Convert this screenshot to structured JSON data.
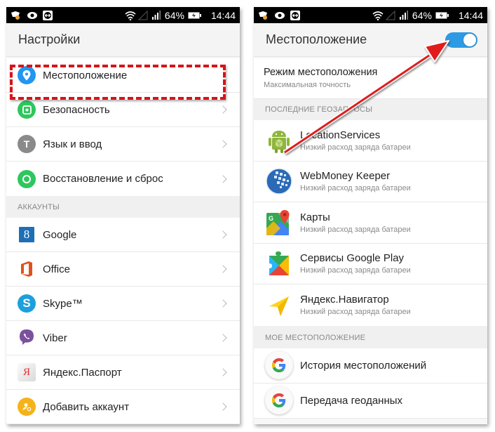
{
  "status_bar": {
    "battery": "64%",
    "time": "14:44",
    "left_icons": [
      "app-notification-icon",
      "eye-icon",
      "teamviewer-icon"
    ],
    "right_icons": [
      "wifi-icon",
      "no-signal-icon",
      "cell-signal-icon",
      "battery-charging-icon"
    ]
  },
  "left_screen": {
    "title": "Настройки",
    "settings_items": [
      {
        "label": "Местоположение",
        "icon": "location-pin-icon",
        "color": "#2196f3",
        "highlighted": true
      },
      {
        "label": "Безопасность",
        "icon": "security-icon",
        "color": "#2ec75d"
      },
      {
        "label": "Язык и ввод",
        "icon": "language-icon",
        "color": "#8a8a8a",
        "glyph": "T"
      },
      {
        "label": "Восстановление и сброс",
        "icon": "backup-reset-icon",
        "color": "#2ec75d"
      }
    ],
    "accounts_header": "АККАУНТЫ",
    "accounts": [
      {
        "label": "Google",
        "icon": "google-account-icon",
        "glyph": "8"
      },
      {
        "label": "Office",
        "icon": "office-icon"
      },
      {
        "label": "Skype™",
        "icon": "skype-icon",
        "glyph": "S"
      },
      {
        "label": "Viber",
        "icon": "viber-icon"
      },
      {
        "label": "Яндекс.Паспорт",
        "icon": "yandex-passport-icon",
        "glyph": "Я"
      },
      {
        "label": "Добавить аккаунт",
        "icon": "add-account-icon"
      }
    ],
    "highlight_color": "#d7141a"
  },
  "right_screen": {
    "title": "Местоположение",
    "toggle_on": true,
    "toggle_color": "#2d9be3",
    "mode": {
      "title": "Режим местоположения",
      "subtitle": "Максимальная точность"
    },
    "recent_header": "ПОСЛЕДНИЕ ГЕОЗАПРОСЫ",
    "recent_apps": [
      {
        "name": "LocationServices",
        "subtitle": "Низкий расход заряда батареи",
        "icon": "android-icon"
      },
      {
        "name": "WebMoney Keeper",
        "subtitle": "Низкий расход заряда батареи",
        "icon": "webmoney-icon"
      },
      {
        "name": "Карты",
        "subtitle": "Низкий расход заряда батареи",
        "icon": "google-maps-icon"
      },
      {
        "name": "Сервисы Google Play",
        "subtitle": "Низкий расход заряда батареи",
        "icon": "google-play-services-icon"
      },
      {
        "name": "Яндекс.Навигатор",
        "subtitle": "Низкий расход заряда батареи",
        "icon": "yandex-navigator-icon"
      }
    ],
    "my_location_header": "МОЕ МЕСТОПОЛОЖЕНИЕ",
    "my_location_items": [
      {
        "label": "История местоположений",
        "icon": "google-g-icon"
      },
      {
        "label": "Передача геоданных",
        "icon": "google-g-icon"
      }
    ]
  },
  "annotation": {
    "arrow_color": "#e01b1b"
  }
}
